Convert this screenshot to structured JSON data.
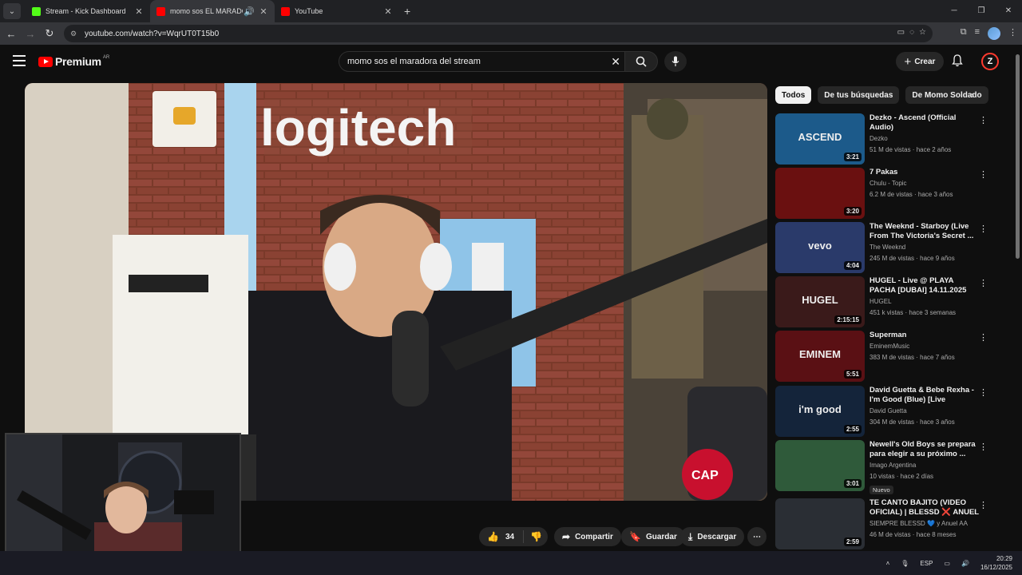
{
  "browser": {
    "tabs": [
      {
        "title": "Stream - Kick Dashboard",
        "favicon_color": "#53fc18"
      },
      {
        "title": "momo sos EL MARADONA",
        "favicon_color": "#ff0000"
      },
      {
        "title": "YouTube",
        "favicon_color": "#ff0000"
      }
    ],
    "url": "youtube.com/watch?v=WqrUT0T15b0"
  },
  "youtube": {
    "logo_text": "Premium",
    "country_code": "AR",
    "search_value": "momo sos el maradora del stream",
    "create_label": "Crear",
    "avatar_letter": "Z"
  },
  "actions": {
    "like_count": "34",
    "share_label": "Compartir",
    "save_label": "Guardar",
    "download_label": "Descargar"
  },
  "chips": [
    "Todos",
    "De tus búsquedas",
    "De Momo Soldado"
  ],
  "recommendations": [
    {
      "title": "Dezko - Ascend (Official Audio)",
      "channel": "Dezko",
      "stats": "51 M de vistas · hace 2 años",
      "duration": "3:21",
      "color": "#1c5a8a",
      "thumb_text": "ASCEND"
    },
    {
      "title": "7 Pakas",
      "channel": "Chulu - Topic",
      "stats": "6.2 M de vistas · hace 3 años",
      "duration": "3:20",
      "color": "#6a1010",
      "thumb_text": ""
    },
    {
      "title": "The Weeknd - Starboy (Live From The Victoria's Secret ...",
      "channel": "The Weeknd",
      "stats": "245 M de vistas · hace 9 años",
      "duration": "4:04",
      "color": "#2a3a6a",
      "thumb_text": "vevo"
    },
    {
      "title": "HUGEL - Live @ PLAYA PACHA [DUBAI] 14.11.2025",
      "channel": "HUGEL",
      "stats": "451 k vistas · hace 3 semanas",
      "duration": "2:15:15",
      "color": "#3a1a1a",
      "thumb_text": "HUGEL"
    },
    {
      "title": "Superman",
      "channel": "EminemMusic",
      "stats": "383 M de vistas · hace 7 años",
      "duration": "5:51",
      "color": "#5a1014",
      "thumb_text": "EMINEM"
    },
    {
      "title": "David Guetta & Bebe Rexha - I'm Good (Blue) [Live Performance]",
      "channel": "David Guetta",
      "stats": "304 M de vistas · hace 3 años",
      "duration": "2:55",
      "color": "#14243a",
      "thumb_text": "i'm good"
    },
    {
      "title": "Newell's Old Boys se prepara para elegir a su próximo ...",
      "channel": "Imago Argentina",
      "stats": "10 vistas · hace 2 días",
      "duration": "3:01",
      "color": "#2f5a3a",
      "thumb_text": "",
      "badge": "Nuevo"
    },
    {
      "title": "TE CANTO BAJITO (VIDEO OFICIAL) | BLESSD ❌ ANUEL ...",
      "channel": "SIEMPRE BLESSD 💙 y Anuel AA",
      "stats": "46 M de vistas · hace 8 meses",
      "duration": "2:59",
      "color": "#2a2e34",
      "thumb_text": ""
    }
  ],
  "taskbar": {
    "language": "ESP",
    "time": "20:29",
    "date": "16/12/2025"
  }
}
